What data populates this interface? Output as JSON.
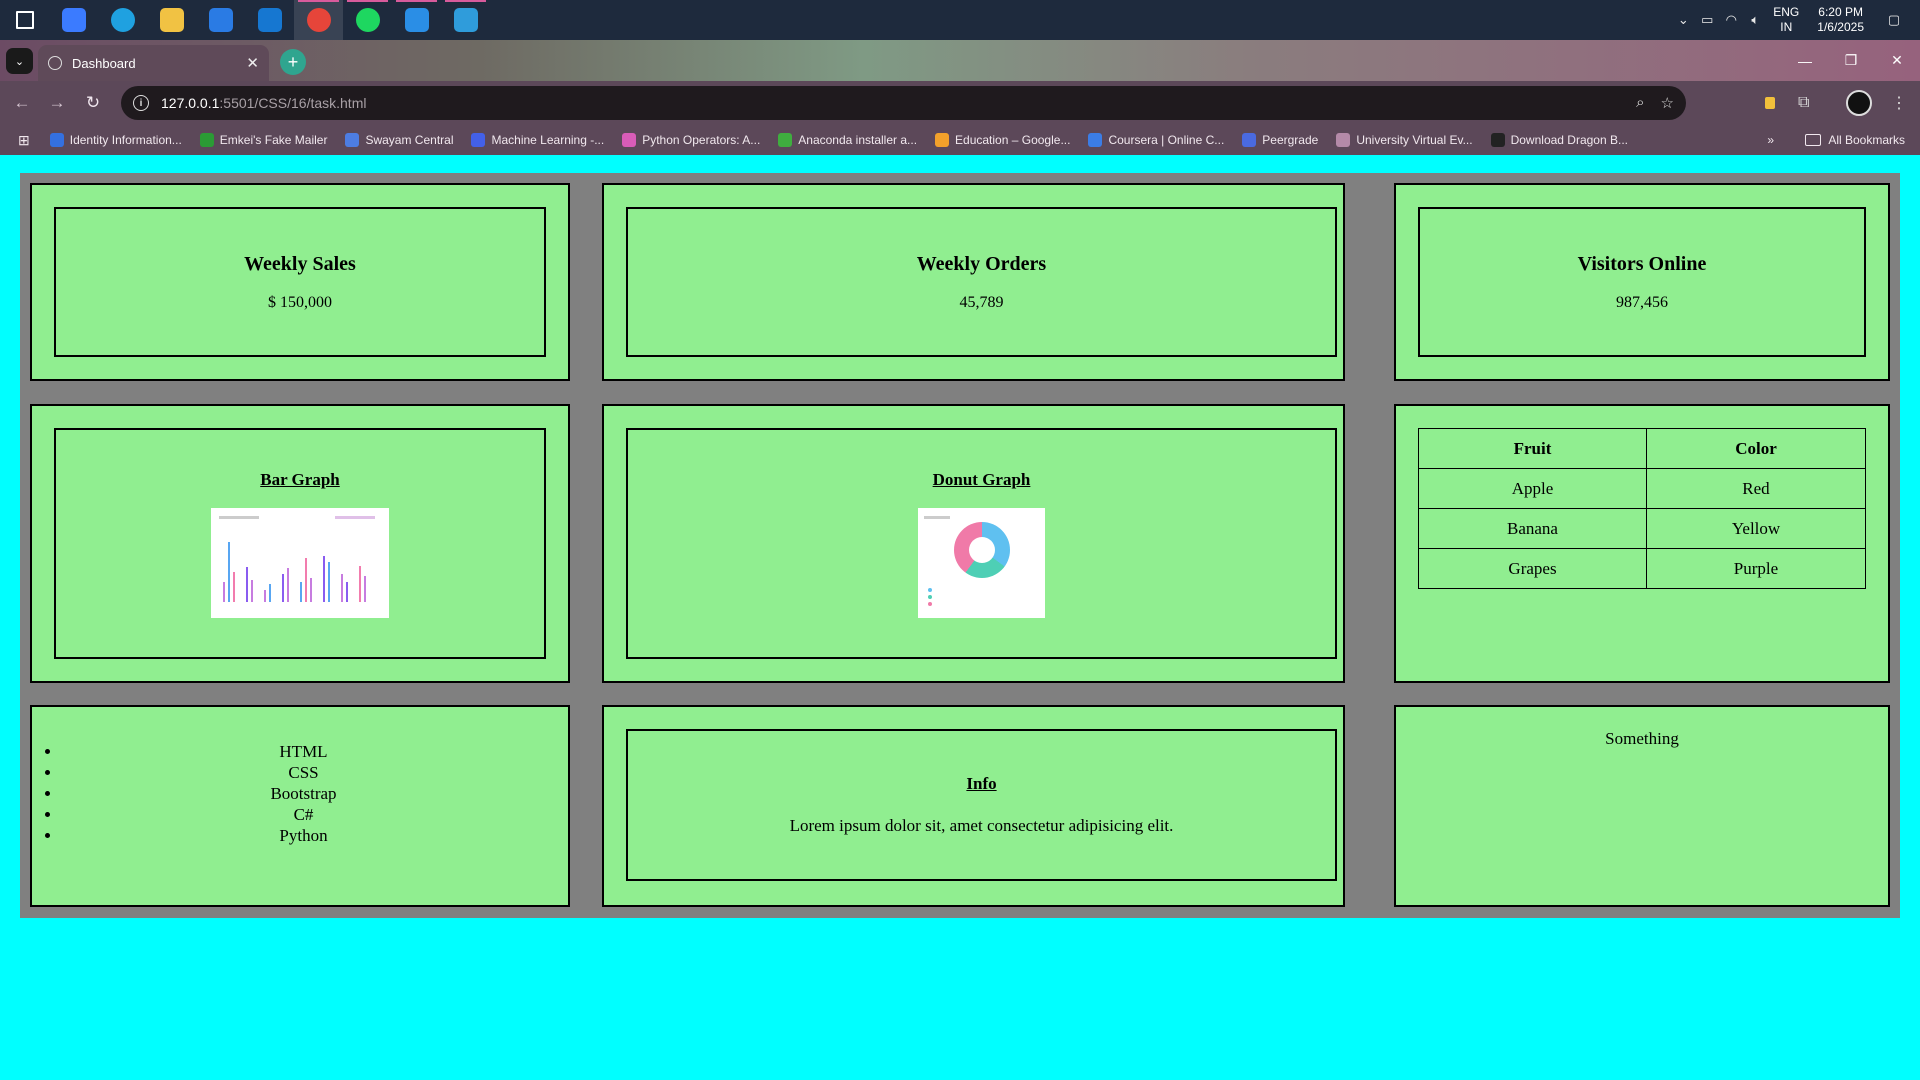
{
  "taskbar": {
    "apps": [
      {
        "name": "start-icon",
        "color": "#ffffff"
      },
      {
        "name": "copilot-icon",
        "color": "#3b7bff"
      },
      {
        "name": "edge-icon",
        "color": "#1fa1e0"
      },
      {
        "name": "file-explorer-icon",
        "color": "#f1c243"
      },
      {
        "name": "store-icon",
        "color": "#2a7be4"
      },
      {
        "name": "outlook-icon",
        "color": "#1677d1"
      },
      {
        "name": "chrome-icon",
        "color": "#e6453a"
      },
      {
        "name": "spotify-icon",
        "color": "#1ed760"
      },
      {
        "name": "vscode-icon",
        "color": "#2a8ee6"
      },
      {
        "name": "paint-icon",
        "color": "#2f9cdb"
      }
    ],
    "lang_top": "ENG",
    "lang_bottom": "IN",
    "time": "6:20 PM",
    "date": "1/6/2025"
  },
  "browser": {
    "tab_title": "Dashboard",
    "url_host": "127.0.0.1",
    "url_path": ":5501/CSS/16/task.html"
  },
  "bookmarks": {
    "items": [
      {
        "label": "Identity Information...",
        "color": "#3470e0"
      },
      {
        "label": "Emkei's Fake Mailer",
        "color": "#2b9b35"
      },
      {
        "label": "Swayam Central",
        "color": "#4d7de2"
      },
      {
        "label": "Machine Learning -...",
        "color": "#4360e8"
      },
      {
        "label": "Python Operators: A...",
        "color": "#d95cb8"
      },
      {
        "label": "Anaconda installer a...",
        "color": "#3fae3f"
      },
      {
        "label": "Education – Google...",
        "color": "#f2a12b"
      },
      {
        "label": "Coursera | Online C...",
        "color": "#3b7de6"
      },
      {
        "label": "Peergrade",
        "color": "#4a6ae0"
      },
      {
        "label": "University Virtual Ev...",
        "color": "#b48aa8"
      },
      {
        "label": "Download Dragon B...",
        "color": "#222222"
      }
    ],
    "more": "»",
    "all_label": "All Bookmarks"
  },
  "dashboard": {
    "stats": [
      {
        "title": "Weekly Sales",
        "value": "$ 150,000"
      },
      {
        "title": "Weekly Orders",
        "value": "45,789"
      },
      {
        "title": "Visitors Online",
        "value": "987,456"
      }
    ],
    "bar_graph_title": "Bar Graph",
    "donut_graph_title": "Donut Graph",
    "table": {
      "headers": [
        "Fruit",
        "Color"
      ],
      "rows": [
        [
          "Apple",
          "Red"
        ],
        [
          "Banana",
          "Yellow"
        ],
        [
          "Grapes",
          "Purple"
        ]
      ]
    },
    "skills": [
      "HTML",
      "CSS",
      "Bootstrap",
      "C#",
      "Python"
    ],
    "info_title": "Info",
    "info_text": "Lorem ipsum dolor sit, amet consectetur adipisicing elit.",
    "something": "Something"
  }
}
